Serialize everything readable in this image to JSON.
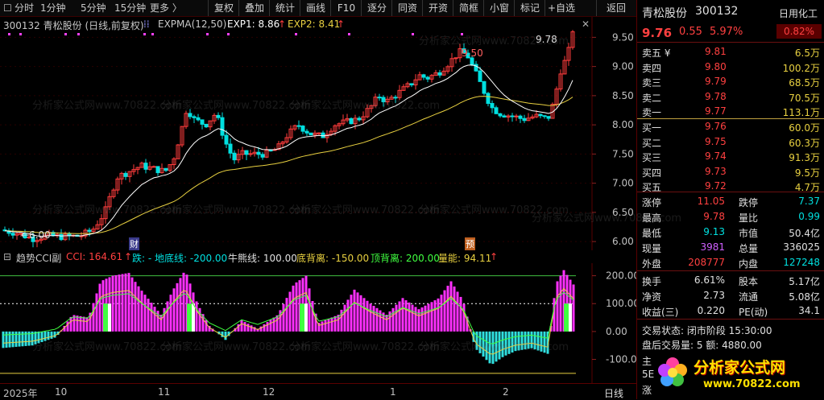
{
  "toolbar": {
    "left_items": [
      "分时",
      "1分钟",
      "5分钟",
      "15分钟",
      "更多 〉"
    ],
    "buttons": [
      "复权",
      "叠加",
      "统计",
      "画线",
      "F10",
      "逐分",
      "同资",
      "开资",
      "简框",
      "小窗",
      "标记",
      "+自选",
      "返回"
    ]
  },
  "chart_header": {
    "code_name": "300132  青松股份 (日线,前复权)",
    "indicator": "EXPMA(12,50)",
    "exp1_label": "EXP1: 8.86",
    "exp1_arrow": "↑",
    "exp2_label": "EXP2: 8.41",
    "exp2_arrow": "↑"
  },
  "main_chart": {
    "y_ticks": [
      "9.50",
      "9.00",
      "8.50",
      "8.00",
      "7.50",
      "7.00",
      "6.50",
      "6.00"
    ],
    "y_tick_values": [
      9.5,
      9.0,
      8.5,
      8.0,
      7.5,
      7.0,
      6.5,
      6.0
    ],
    "high_annotation": "9.78",
    "mid_annotation": "9.50",
    "low_annotation": "6.00",
    "marker_cai": "财",
    "marker_yu": "预",
    "colors": {
      "up": "#ff3c3c",
      "down": "#00e0e0",
      "exp1": "#ffffff",
      "exp2": "#e8d040"
    }
  },
  "sub_header": {
    "name": "趋势CCI副",
    "cci": "CCI: 164.61",
    "cci_arrow": "↑",
    "die": "跌: -",
    "floor": "地底线: -200.00",
    "bull": "牛熊线: 100.00",
    "bottom_div": "底背离: -150.00",
    "top_div": "顶背离: 200.00",
    "energy": "量能: 94.11",
    "energy_arrow": "↑"
  },
  "sub_chart": {
    "y_ticks": [
      "200.00",
      "100.00",
      "0.00",
      "-100.00"
    ],
    "y_tick_values": [
      200,
      100,
      0,
      -100
    ]
  },
  "bottom_axis": {
    "labels": [
      "2025年",
      "10",
      "11",
      "12",
      "1",
      "2"
    ],
    "period": "日线"
  },
  "right_panel": {
    "stock_name": "青松股份",
    "stock_code": "300132",
    "industry": "日用化工",
    "price": "9.76",
    "change": "0.55",
    "change_pct": "5.97%",
    "industry_pct": "0.82%",
    "sells": [
      {
        "label": "卖五 ¥",
        "price": "9.81",
        "vol": "6.5万"
      },
      {
        "label": "卖四",
        "price": "9.80",
        "vol": "100.2万"
      },
      {
        "label": "卖三",
        "price": "9.79",
        "vol": "68.5万"
      },
      {
        "label": "卖二",
        "price": "9.78",
        "vol": "70.5万"
      },
      {
        "label": "卖一",
        "price": "9.77",
        "vol": "113.1万"
      }
    ],
    "buys": [
      {
        "label": "买一",
        "price": "9.76",
        "vol": "60.0万"
      },
      {
        "label": "买二",
        "price": "9.75",
        "vol": "60.3万"
      },
      {
        "label": "买三",
        "price": "9.74",
        "vol": "91.3万"
      },
      {
        "label": "买四",
        "price": "9.73",
        "vol": "9.5万"
      },
      {
        "label": "买五",
        "price": "9.72",
        "vol": "4.7万"
      }
    ],
    "stats1": [
      {
        "l1": "涨停",
        "v1": "11.05",
        "c1": "#ff4040",
        "l2": "跌停",
        "v2": "7.37",
        "c2": "#00e0e0"
      },
      {
        "l1": "最高",
        "v1": "9.78",
        "c1": "#ff4040",
        "l2": "量比",
        "v2": "0.99",
        "c2": "#00e0e0"
      },
      {
        "l1": "最低",
        "v1": "9.13",
        "c1": "#00e0e0",
        "l2": "市值",
        "v2": "50.4亿",
        "c2": "#e0e0e0"
      },
      {
        "l1": "现量",
        "v1": "3981",
        "c1": "#d060ff",
        "l2": "总量",
        "v2": "336025",
        "c2": "#e0e0e0"
      },
      {
        "l1": "外盘",
        "v1": "208777",
        "c1": "#ff4040",
        "l2": "内盘",
        "v2": "127248",
        "c2": "#00e0e0"
      }
    ],
    "stats2": [
      {
        "l1": "换手",
        "v1": "6.61%",
        "l2": "股本",
        "v2": "5.17亿"
      },
      {
        "l1": "净资",
        "v1": "2.73",
        "l2": "流通",
        "v2": "5.08亿"
      },
      {
        "l1": "收益(三)",
        "v1": "0.220",
        "l2": "PE(动)",
        "v2": "34.1"
      }
    ],
    "trade_status": "交易状态: 闭市阶段 15:30:00",
    "after_hours": "盘后交易量: 5   额: 4880.00",
    "partial1": "主",
    "partial2": "5E",
    "partial3": "涨",
    "logo_text": "分析家公式网",
    "logo_url": "www.70822.com"
  },
  "watermark": "分析家公式网www.70822.com"
}
